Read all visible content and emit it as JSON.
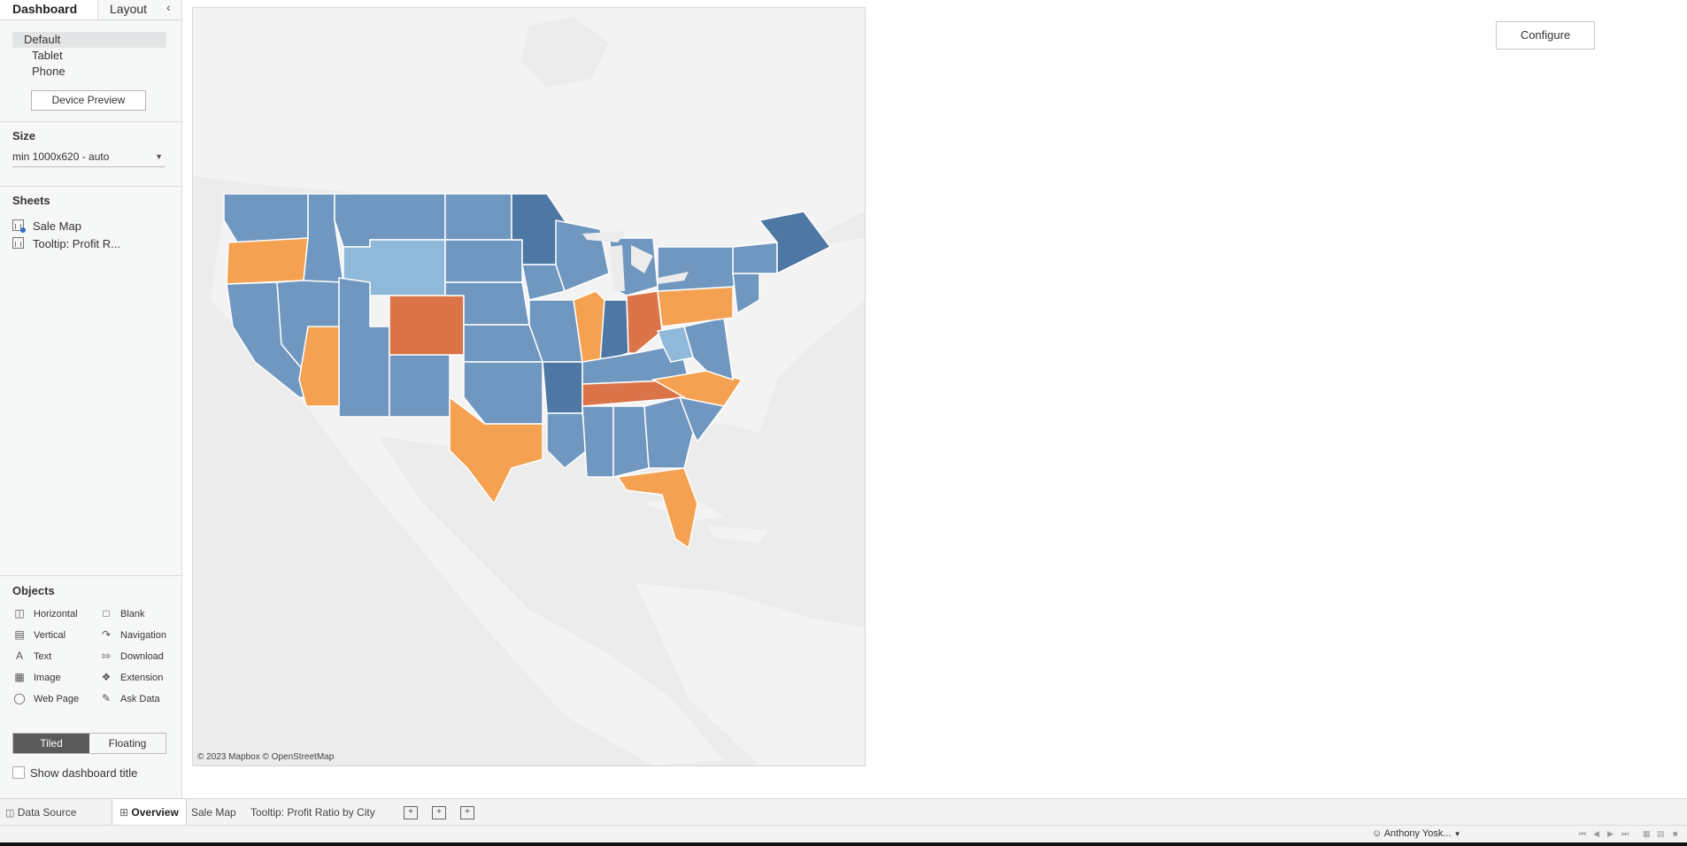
{
  "sidebar": {
    "tabs": {
      "dashboard": "Dashboard",
      "layout": "Layout",
      "collapse_icon": "chevron-left-icon"
    },
    "devices": [
      "Default",
      "Tablet",
      "Phone"
    ],
    "device_preview": "Device Preview",
    "size": {
      "title": "Size",
      "value": "min 1000x620 - auto"
    },
    "sheets": {
      "title": "Sheets",
      "items": [
        "Sale Map",
        "Tooltip: Profit R..."
      ]
    },
    "objects": {
      "title": "Objects",
      "left": [
        "Horizontal",
        "Vertical",
        "Text",
        "Image",
        "Web Page"
      ],
      "right": [
        "Blank",
        "Navigation",
        "Download",
        "Extension",
        "Ask Data"
      ]
    },
    "layout_toggle": {
      "tiled": "Tiled",
      "floating": "Floating"
    },
    "show_title": "Show dashboard title"
  },
  "map": {
    "attribution": "© 2023 Mapbox © OpenStreetMap",
    "colors": {
      "orange": "#f4a252",
      "dark_orange": "#dc744a",
      "blue": "#6f97bf",
      "light_blue": "#8fb8d9",
      "dark_blue": "#4e77a3",
      "land": "#f3f3f3",
      "water": "#ececec"
    }
  },
  "configure": "Configure",
  "bottom_tabs": {
    "data_source": "Data Source",
    "overview": "Overview",
    "sale_map": "Sale Map",
    "tooltip": "Tooltip: Profit Ratio by City"
  },
  "status": {
    "user": "Anthony Yosk..."
  }
}
